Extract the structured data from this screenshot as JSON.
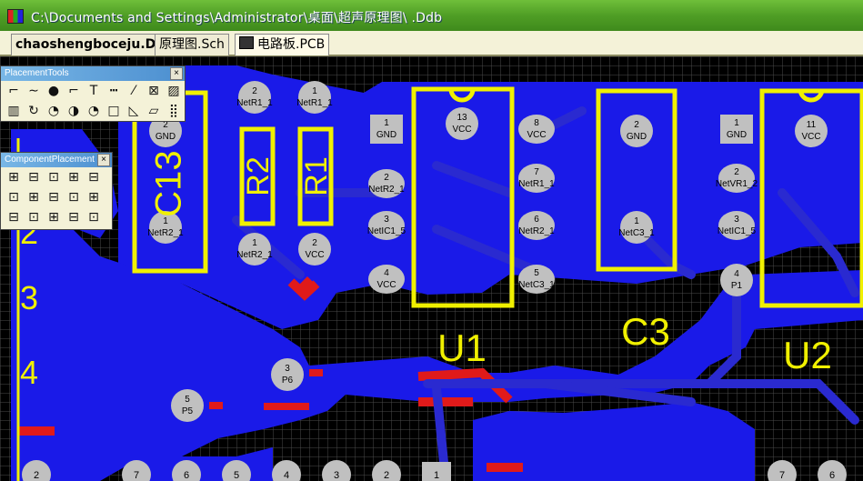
{
  "window": {
    "title": "C:\\Documents and Settings\\Administrator\\桌面\\超声原理图\\                        .Ddb"
  },
  "tabs": [
    {
      "label": "chaoshengboceju.Ddb"
    },
    {
      "label": "原理图.Sch"
    },
    {
      "label": "电路板.PCB"
    }
  ],
  "palettes": {
    "placement_tools": {
      "title": "PlacementTools",
      "close": "×"
    },
    "component_placement": {
      "title": "ComponentPlacement",
      "close": "×"
    }
  },
  "board": {
    "colors": {
      "board": "#1a1ae8",
      "grid": "#000000",
      "silk": "#f0f000",
      "pad": "#c0c0c0",
      "track": "#e01a1a"
    },
    "left_labels": [
      "2",
      "3",
      "4"
    ],
    "designators": [
      {
        "text": "C13"
      },
      {
        "text": "R2"
      },
      {
        "text": "R1"
      },
      {
        "text": "U1"
      },
      {
        "text": "C3"
      },
      {
        "text": "U2"
      }
    ],
    "pads": [
      {
        "num": "2",
        "net": "NetR1_1"
      },
      {
        "num": "1",
        "net": "NetR1_1"
      },
      {
        "num": "1",
        "net": "NetR2_1"
      },
      {
        "num": "2",
        "net": "VCC"
      },
      {
        "num": "2",
        "net": "GND"
      },
      {
        "num": "1",
        "net": "NetR2_1"
      },
      {
        "num": "1",
        "net": "GND"
      },
      {
        "num": "2",
        "net": "NetR2_1"
      },
      {
        "num": "3",
        "net": "NetIC1_5"
      },
      {
        "num": "4",
        "net": "VCC"
      },
      {
        "num": "13",
        "net": "VCC"
      },
      {
        "num": "8",
        "net": "VCC"
      },
      {
        "num": "7",
        "net": "NetR1_1"
      },
      {
        "num": "6",
        "net": "NetR2_1"
      },
      {
        "num": "5",
        "net": "NetC3_1"
      },
      {
        "num": "2",
        "net": "GND"
      },
      {
        "num": "1",
        "net": "NetC3_1"
      },
      {
        "num": "1",
        "net": "GND"
      },
      {
        "num": "2",
        "net": "NetVR1_2"
      },
      {
        "num": "3",
        "net": "NetIC1_5"
      },
      {
        "num": "4",
        "net": "P1"
      },
      {
        "num": "11",
        "net": "VCC"
      },
      {
        "num": "3",
        "net": "P6"
      },
      {
        "num": "5",
        "net": "P5"
      }
    ],
    "bottom_pads": [
      "2",
      "7",
      "6",
      "5",
      "4",
      "3",
      "2",
      "1",
      "7",
      "6"
    ]
  }
}
